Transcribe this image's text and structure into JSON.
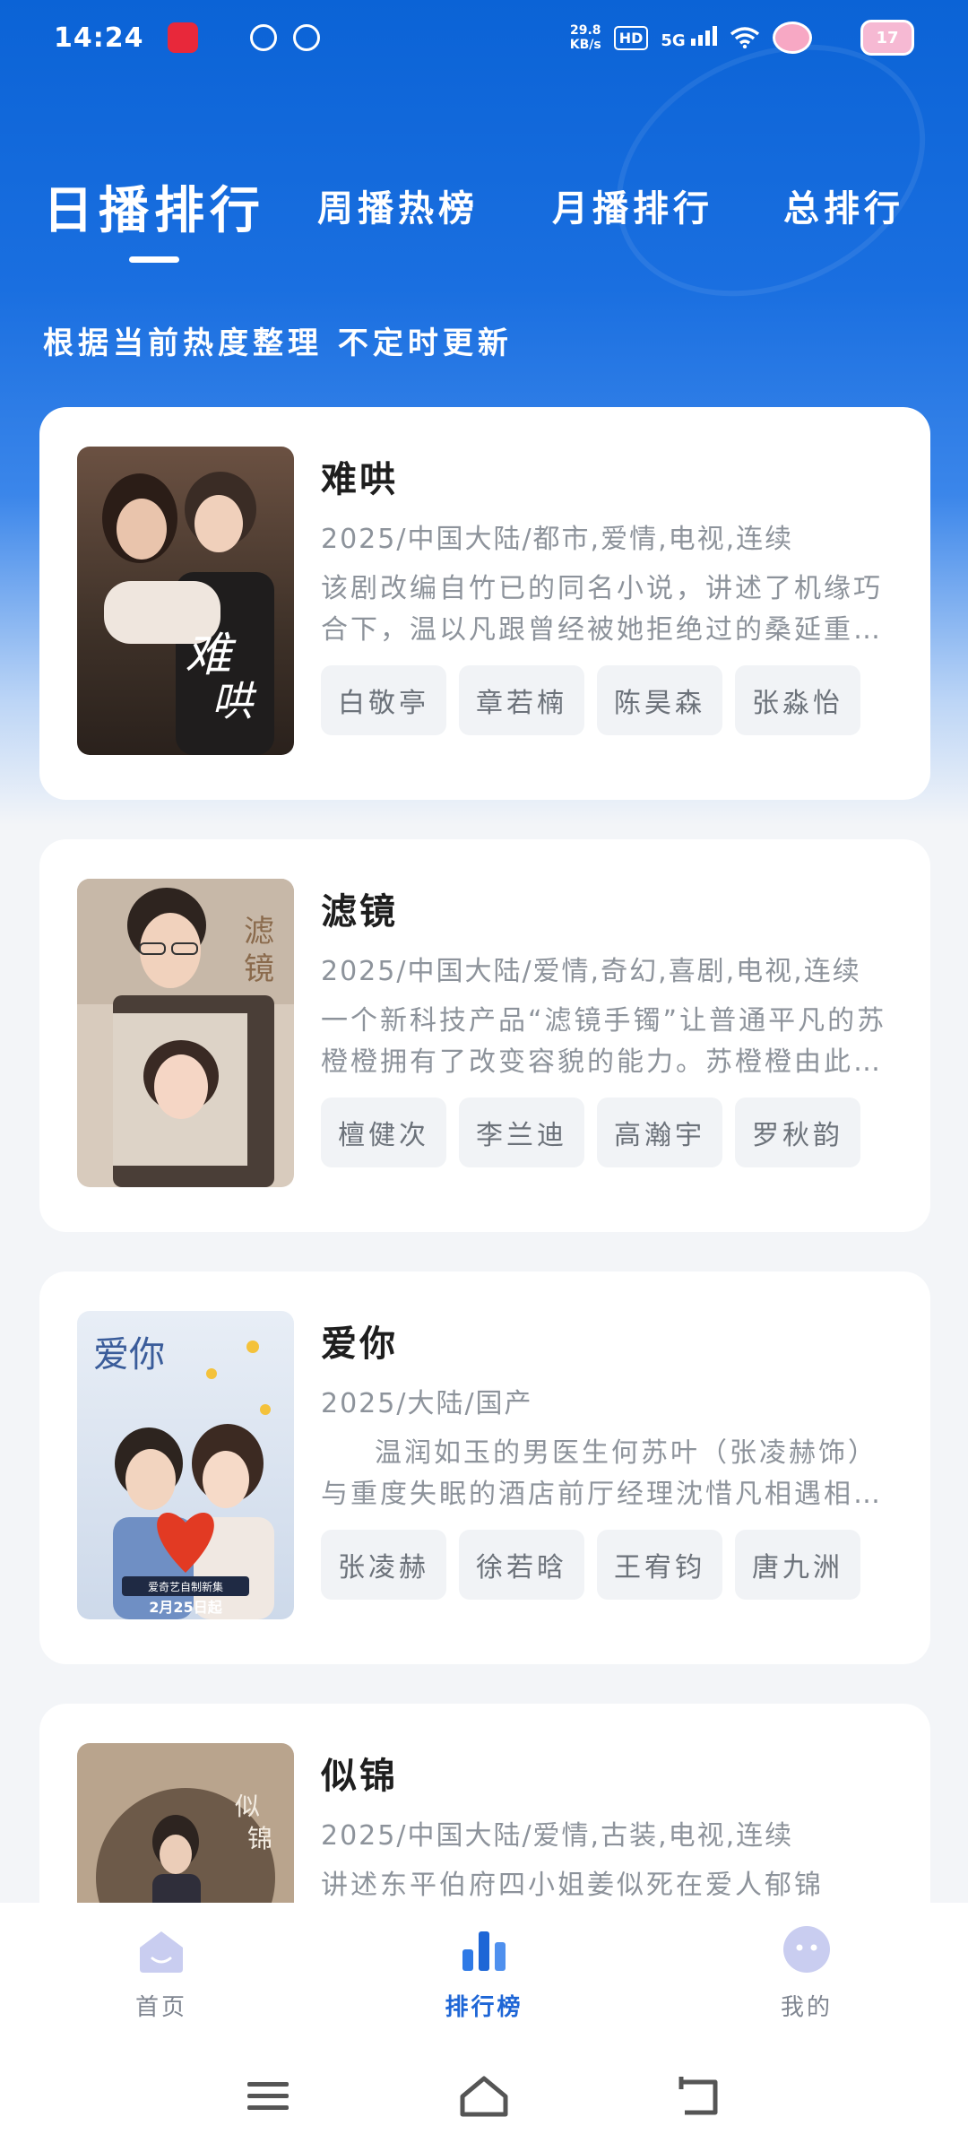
{
  "status_bar": {
    "time": "14:24",
    "net_speed_value": "29.8",
    "net_speed_unit": "KB/s",
    "hd_label": "HD",
    "network_label": "5G",
    "battery_level": "17"
  },
  "tabs": [
    {
      "label": "日播排行",
      "active": true
    },
    {
      "label": "周播热榜",
      "active": false
    },
    {
      "label": "月播排行",
      "active": false
    },
    {
      "label": "总排行",
      "active": false
    }
  ],
  "subtitle": "根据当前热度整理 不定时更新",
  "items": [
    {
      "title": "难哄",
      "meta": "2025/中国大陆/都市,爱情,电视,连续",
      "description": "该剧改编自竹已的同名小说，讲述了机缘巧合下，温以凡跟曾经被她拒绝过的桑延重逢的故事",
      "cast": [
        "白敬亭",
        "章若楠",
        "陈昊森",
        "张淼怡"
      ],
      "poster_text": "难哄"
    },
    {
      "title": "滤镜",
      "meta": "2025/中国大陆/爱情,奇幻,喜剧,电视,连续",
      "description": "一个新科技产品“滤镜手镯”让普通平凡的苏橙橙拥有了改变容貌的能力。苏橙橙由此开启了一段奇妙的旅程",
      "cast": [
        "檀健次",
        "李兰迪",
        "高瀚宇",
        "罗秋韵"
      ],
      "poster_text": "滤镜"
    },
    {
      "title": "爱你",
      "meta": "2025/大陆/国产",
      "description": "温润如玉的男医生何苏叶（张凌赫饰）与重度失眠的酒店前厅经理沈惜凡相遇相知的故事",
      "cast": [
        "张凌赫",
        "徐若晗",
        "王宥钧",
        "唐九洲"
      ],
      "poster_text": "爱你",
      "poster_caption": "爱奇艺自制新集",
      "poster_date": "2月25日起"
    },
    {
      "title": "似锦",
      "meta": "2025/中国大陆/爱情,古装,电视,连续",
      "description": "讲述东平伯府四小姐姜似死在爱人郁锦",
      "cast": [],
      "poster_text": "似锦"
    }
  ],
  "bottom_nav": [
    {
      "label": "首页",
      "icon": "home-face-icon",
      "active": false
    },
    {
      "label": "排行榜",
      "icon": "bar-chart-icon",
      "active": true
    },
    {
      "label": "我的",
      "icon": "profile-face-icon",
      "active": false
    }
  ],
  "system_nav": [
    "menu-icon",
    "home-icon",
    "back-icon"
  ],
  "colors": {
    "accent": "#1e66d6",
    "header_blue": "#0b63d6",
    "text_primary": "#1e1e1e",
    "text_secondary": "#8d939b",
    "chip_bg": "#f1f3f6"
  }
}
